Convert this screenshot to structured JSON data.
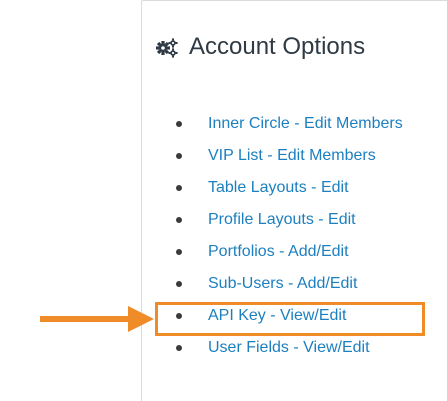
{
  "panel": {
    "title": "Account Options",
    "title_icon": "gears-icon"
  },
  "options": [
    {
      "label": "Inner Circle - Edit Members"
    },
    {
      "label": "VIP List - Edit Members"
    },
    {
      "label": "Table Layouts - Edit"
    },
    {
      "label": "Profile Layouts - Edit"
    },
    {
      "label": "Portfolios - Add/Edit"
    },
    {
      "label": "Sub-Users - Add/Edit"
    },
    {
      "label": "API Key - View/Edit"
    },
    {
      "label": "User Fields - View/Edit"
    }
  ],
  "annotation": {
    "highlight_color": "#f08c28",
    "highlighted_option": "API Key - View/Edit",
    "pointer": "arrow-right-icon"
  },
  "colors": {
    "link": "#1c7fbf",
    "title": "#2f3a44"
  }
}
